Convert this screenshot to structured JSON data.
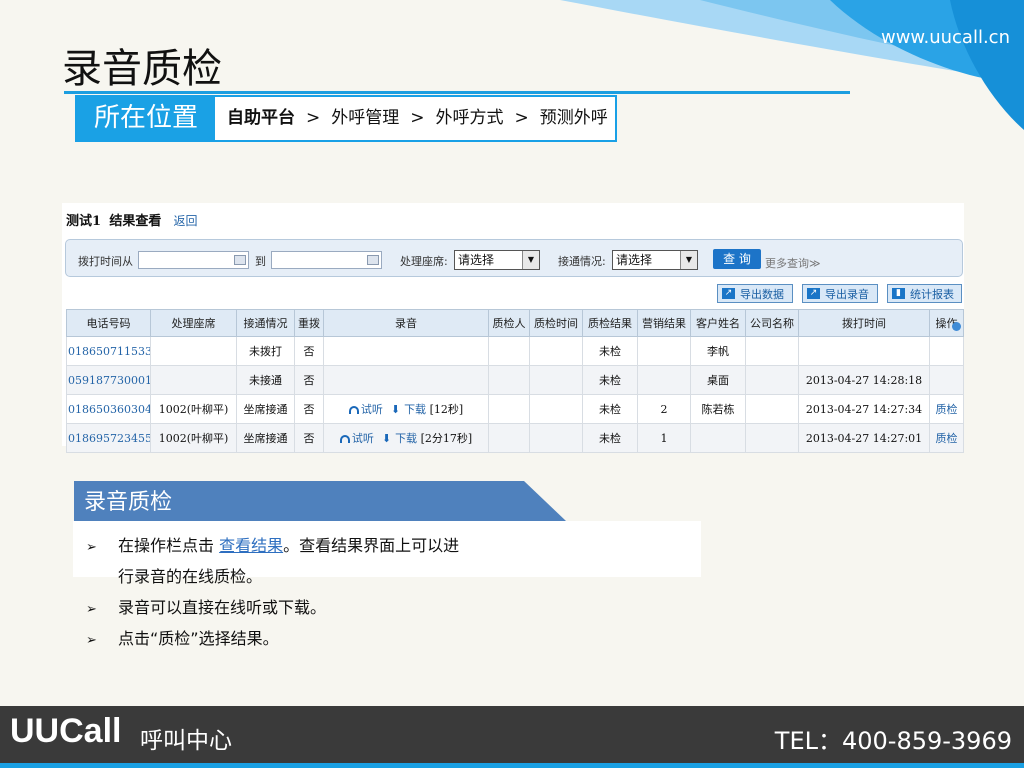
{
  "site_url": "www.uucall.cn",
  "slide_title": "录音质检",
  "location": {
    "label": "所在位置",
    "crumbs": [
      "自助平台",
      "外呼管理",
      "外呼方式",
      "预测外呼"
    ],
    "separator": ">"
  },
  "screenshot": {
    "task_name": "测试1",
    "view_title": "结果查看",
    "back_link": "返回",
    "filter": {
      "time_from_label": "拨打时间从",
      "to_label": "到",
      "seat_label": "处理座席:",
      "seat_value": "请选择",
      "status_label": "接通情况:",
      "status_value": "请选择",
      "query_button": "查 询",
      "more_query": "更多查询"
    },
    "toolbar": {
      "export_data": "导出数据",
      "export_recording": "导出录音",
      "stats_report": "统计报表"
    },
    "table": {
      "headers": [
        "电话号码",
        "处理座席",
        "接通情况",
        "重拨",
        "录音",
        "质检人",
        "质检时间",
        "质检结果",
        "营销结果",
        "客户姓名",
        "公司名称",
        "拨打时间",
        "操作"
      ],
      "rows": [
        {
          "phone": "018650711533",
          "seat": "",
          "status": "未拨打",
          "redial": "否",
          "listen": "",
          "download": "",
          "duration": "",
          "inspector": "",
          "qc_time": "",
          "qc_result": "未检",
          "sales": "",
          "customer": "李帆",
          "company": "",
          "call_time": "",
          "action": ""
        },
        {
          "phone": "059187730001",
          "seat": "",
          "status": "未接通",
          "redial": "否",
          "listen": "",
          "download": "",
          "duration": "",
          "inspector": "",
          "qc_time": "",
          "qc_result": "未检",
          "sales": "",
          "customer": "桌面",
          "company": "",
          "call_time": "2013-04-27 14:28:18",
          "action": ""
        },
        {
          "phone": "018650360304",
          "seat": "1002(叶柳平)",
          "status": "坐席接通",
          "redial": "否",
          "listen": "试听",
          "download": "下载",
          "duration": "[12秒]",
          "inspector": "",
          "qc_time": "",
          "qc_result": "未检",
          "sales": "2",
          "customer": "陈若栋",
          "company": "",
          "call_time": "2013-04-27 14:27:34",
          "action": "质检"
        },
        {
          "phone": "018695723455",
          "seat": "1002(叶柳平)",
          "status": "坐席接通",
          "redial": "否",
          "listen": "试听",
          "download": "下载",
          "duration": "[2分17秒]",
          "inspector": "",
          "qc_time": "",
          "qc_result": "未检",
          "sales": "1",
          "customer": "",
          "company": "",
          "call_time": "2013-04-27 14:27:01",
          "action": "质检"
        }
      ]
    }
  },
  "section_title": "录音质检",
  "bullets": {
    "b1_prefix": "在操作栏点击 ",
    "b1_link": "查看结果",
    "b1_suffix": "。查看结果界面上可以进",
    "b1_line2": "行录音的在线质检。",
    "b2": "录音可以直接在线听或下载。",
    "b3": "点击“质检”选择结果。"
  },
  "footer": {
    "brand": "UUCall",
    "brand_sub": "呼叫中心",
    "tel": "TEL：400-859-3969"
  },
  "colors": {
    "accent_blue": "#1aa1e5",
    "banner_blue": "#4f81bd",
    "footer_dark": "#3a3a3a"
  }
}
